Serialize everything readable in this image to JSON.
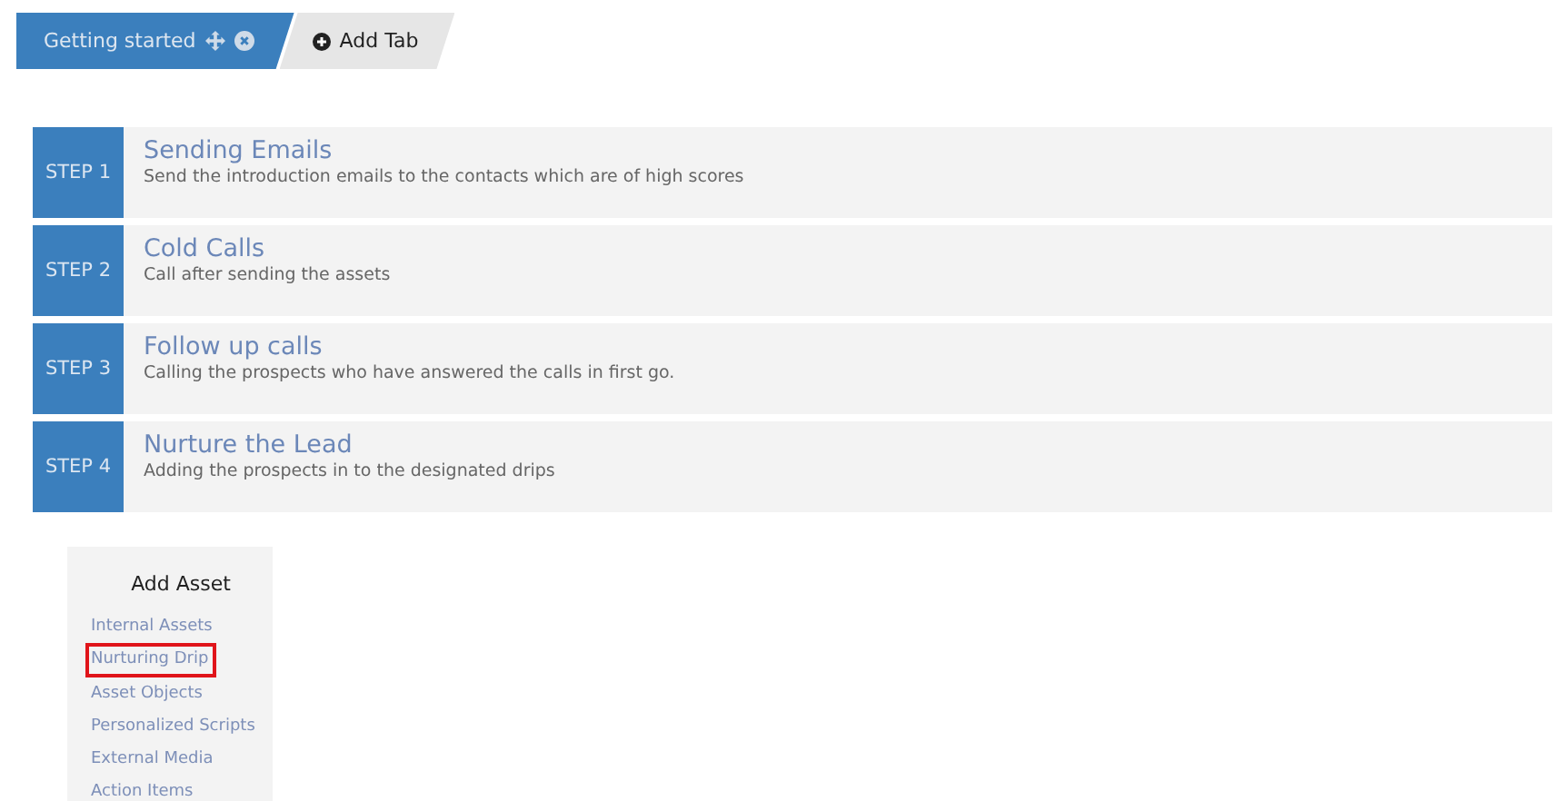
{
  "tabs": [
    {
      "label": "Getting started",
      "selected": true
    },
    {
      "label": "Add Tab",
      "selected": false
    }
  ],
  "steps": [
    {
      "step": "STEP 1",
      "title": "Sending Emails",
      "description": "Send the introduction emails to the contacts which are of high scores"
    },
    {
      "step": "STEP 2",
      "title": "Cold Calls",
      "description": "Call after sending the assets"
    },
    {
      "step": "STEP 3",
      "title": "Follow up calls",
      "description": "Calling the prospects who have answered the calls in first go."
    },
    {
      "step": "STEP 4",
      "title": "Nurture the Lead",
      "description": "Adding the prospects in to the designated drips"
    }
  ],
  "asset_panel": {
    "title": "Add Asset",
    "items": [
      {
        "label": "Internal Assets",
        "highlighted": false
      },
      {
        "label": "Nurturing Drip",
        "highlighted": true
      },
      {
        "label": "Asset Objects",
        "highlighted": false
      },
      {
        "label": "Personalized Scripts",
        "highlighted": false
      },
      {
        "label": "External Media",
        "highlighted": false
      },
      {
        "label": "Action Items",
        "highlighted": false
      }
    ]
  }
}
